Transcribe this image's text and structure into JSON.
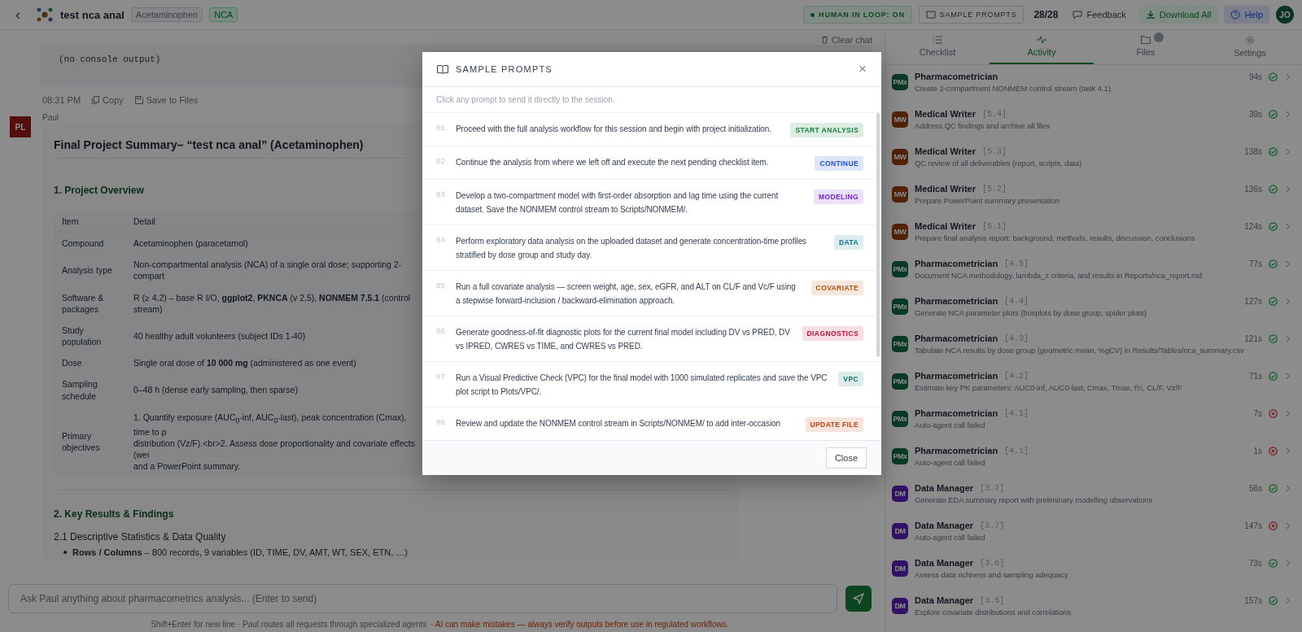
{
  "header": {
    "back": "‹",
    "title": "test nca anal",
    "tags": [
      {
        "label": "Acetaminophen",
        "kind": "neutral"
      },
      {
        "label": "NCA",
        "kind": "accent"
      }
    ],
    "hitl": {
      "label": "HUMAN IN LOOP: ON",
      "on": true
    },
    "sample_prompts": "SAMPLE PROMPTS",
    "counter": "28/28",
    "feedback": "Feedback",
    "download": "Download All",
    "help": "Help",
    "avatar": "JO"
  },
  "chat": {
    "clear": "Clear chat",
    "console": "(no console output)",
    "time": "08:31 PM",
    "copy": "Copy",
    "save": "Save to Files",
    "sender_initials": "PL",
    "sender": "Paul",
    "title": "Final Project Summary– “test nca anal” (Acetaminophen)",
    "section1": "1. Project Overview",
    "table": {
      "columns": [
        "Item",
        "Detail"
      ],
      "rows": [
        {
          "item": "Compound",
          "detail": [
            "Acetaminophen (paracetamol)"
          ]
        },
        {
          "item": "Analysis type",
          "detail": [
            "Non-compartmental analysis (NCA) of a single oral dose; supporting 2-compart"
          ]
        },
        {
          "item": "Software & packages",
          "detail": [
            "R (≥ 4.2) – base R I/O, **ggplot2**, **PKNCA** (v 2.5), **NONMEM 7.5.1** (control stream)"
          ]
        },
        {
          "item": "Study population",
          "detail": [
            "40 healthy adult volunteers (subject IDs 1-40)"
          ]
        },
        {
          "item": "Dose",
          "detail": [
            "Single oral dose of **10 000 mg** (administered as one event)"
          ]
        },
        {
          "item": "Sampling schedule",
          "detail": [
            "0–48 h (dense early sampling, then sparse)"
          ]
        },
        {
          "item": "Primary objectives",
          "detail": [
            "1. Quantify exposure (AUC$_{0}$-inf, AUC$_{0}$-last), peak concentration (Cmax), time to p",
            "distribution (Vz/F).<br>2. Assess dose proportionality and covariate effects (wei",
            "and a PowerPoint summary."
          ]
        }
      ]
    },
    "section2": "2. Key Results & Findings",
    "subsection": "2.1 Descriptive Statistics & Data Quality",
    "bullet": "**Rows / Columns** – 800 records, 9 variables (ID, TIME, DV, AMT, WT, SEX, ETN, …)",
    "input_placeholder": "Ask Paul anything about pharmacometrics analysis... (Enter to send)",
    "hint": "Shift+Enter for new line · Paul routes all requests through specialized agents",
    "warning": "· AI can make mistakes — always verify outputs before use in regulated workflows."
  },
  "panel": {
    "tabs": [
      {
        "label": "Checklist",
        "selected": false
      },
      {
        "label": "Activity",
        "selected": true
      },
      {
        "label": "Files",
        "selected": false,
        "badge": true
      },
      {
        "label": "Settings",
        "selected": false
      }
    ],
    "activity": [
      {
        "initials": "PMx",
        "kind": "pmx",
        "agent": "Pharmacometrician",
        "text": "Create 2-compartment NONMEM control stream (task 4.1).",
        "time": "94s",
        "failed": false
      },
      {
        "initials": "MW",
        "kind": "mw",
        "agent": "Medical Writer",
        "task": "[5.4]",
        "text": "Address QC findings and archive all files",
        "time": "39s",
        "failed": false
      },
      {
        "initials": "MW",
        "kind": "mw",
        "agent": "Medical Writer",
        "task": "[5.3]",
        "text": "QC review of all deliverables (report, scripts, data)",
        "time": "138s",
        "failed": false
      },
      {
        "initials": "MW",
        "kind": "mw",
        "agent": "Medical Writer",
        "task": "[5.2]",
        "text": "Prepare PowerPoint summary presentation",
        "time": "136s",
        "failed": false
      },
      {
        "initials": "MW",
        "kind": "mw",
        "agent": "Medical Writer",
        "task": "[5.1]",
        "text": "Prepare final analysis report: background, methods, results, discussion, conclusions",
        "time": "124s",
        "failed": false
      },
      {
        "initials": "PMx",
        "kind": "pmx",
        "agent": "Pharmacometrician",
        "task": "[4.5]",
        "text": "Document NCA methodology, lambda_z criteria, and results in Reports/nca_report.md",
        "time": "77s",
        "failed": false
      },
      {
        "initials": "PMx",
        "kind": "pmx",
        "agent": "Pharmacometrician",
        "task": "[4.4]",
        "text": "Generate NCA parameter plots (boxplots by dose group, spider plots)",
        "time": "127s",
        "failed": false
      },
      {
        "initials": "PMx",
        "kind": "pmx",
        "agent": "Pharmacometrician",
        "task": "[4.3]",
        "text": "Tabulate NCA results by dose group (geometric mean, %gCV) in Results/Tables/nca_summary.csv",
        "time": "121s",
        "failed": false
      },
      {
        "initials": "PMx",
        "kind": "pmx",
        "agent": "Pharmacometrician",
        "task": "[4.2]",
        "text": "Estimate key PK parameters: AUC0-inf, AUC0-last, Cmax, Tmax, t½, CL/F, Vz/F",
        "time": "71s",
        "failed": false
      },
      {
        "initials": "PMx",
        "kind": "pmx",
        "agent": "Pharmacometrician",
        "task": "[4.1]",
        "text": "Auto-agent call failed",
        "time": "7s",
        "failed": true
      },
      {
        "initials": "PMx",
        "kind": "pmx",
        "agent": "Pharmacometrician",
        "task": "[4.1]",
        "text": "Auto-agent call failed",
        "time": "1s",
        "failed": true
      },
      {
        "initials": "DM",
        "kind": "dm",
        "agent": "Data Manager",
        "task": "[3.7]",
        "text": "Generate EDA summary report with preliminary modelling observations",
        "time": "56s",
        "failed": false
      },
      {
        "initials": "DM",
        "kind": "dm",
        "agent": "Data Manager",
        "task": "[3.7]",
        "text": "Auto-agent call failed",
        "time": "147s",
        "failed": true
      },
      {
        "initials": "DM",
        "kind": "dm",
        "agent": "Data Manager",
        "task": "[3.6]",
        "text": "Assess data richness and sampling adequacy",
        "time": "73s",
        "failed": false
      },
      {
        "initials": "DM",
        "kind": "dm",
        "agent": "Data Manager",
        "task": "[3.5]",
        "text": "Explore covariate distributions and correlations",
        "time": "157s",
        "failed": false
      }
    ]
  },
  "modal": {
    "title": "SAMPLE PROMPTS",
    "close": "×",
    "subtitle": "Click any prompt to send it directly to the session.",
    "close_button": "Close",
    "prompts": [
      {
        "number": "01",
        "text": "Proceed with the full analysis workflow for this session and begin with project initialization.",
        "tag": "START ANALYSIS",
        "color": "#15803d"
      },
      {
        "number": "02",
        "text": "Continue the analysis from where we left off and execute the next pending checklist item.",
        "tag": "CONTINUE",
        "color": "#1d4ed8"
      },
      {
        "number": "03",
        "text": "Develop a two-compartment model with first-order absorption and lag time using the current dataset. Save the NONMEM control stream to Scripts/NONMEM/.",
        "tag": "MODELING",
        "color": "#6d28d9"
      },
      {
        "number": "04",
        "text": "Perform exploratory data analysis on the uploaded dataset and generate concentration-time profiles stratified by dose group and study day.",
        "tag": "DATA",
        "color": "#0e7490"
      },
      {
        "number": "05",
        "text": "Run a full covariate analysis — screen weight, age, sex, eGFR, and ALT on CL/F and Vc/F using a stepwise forward-inclusion / backward-elimination approach.",
        "tag": "COVARIATE",
        "color": "#b45309"
      },
      {
        "number": "06",
        "text": "Generate goodness-of-fit diagnostic plots for the current final model including DV vs PRED, DV vs IPRED, CWRES vs TIME, and CWRES vs PRED.",
        "tag": "DIAGNOSTICS",
        "color": "#be123c"
      },
      {
        "number": "07",
        "text": "Run a Visual Predictive Check (VPC) for the final model with 1000 simulated replicates and save the VPC plot script to Plots/VPC/.",
        "tag": "VPC",
        "color": "#0f766e"
      },
      {
        "number": "08",
        "text": "Review and update the NONMEM control stream in Scripts/NONMEM/ to add inter-occasion",
        "tag": "UPDATE FILE",
        "color": "#c2410c"
      }
    ]
  }
}
